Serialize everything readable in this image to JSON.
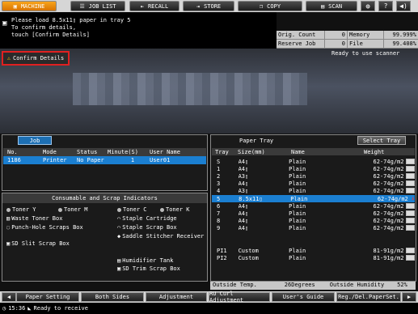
{
  "tabs": [
    {
      "label": "MACHINE",
      "icon": "machine-icon",
      "active": true
    },
    {
      "label": "JOB LIST",
      "icon": "job-list-icon",
      "active": false
    },
    {
      "label": "RECALL",
      "icon": "recall-icon",
      "active": false
    },
    {
      "label": "STORE",
      "icon": "store-icon",
      "active": false
    },
    {
      "label": "COPY",
      "icon": "copy-icon",
      "active": false
    },
    {
      "label": "SCAN",
      "icon": "scan-icon",
      "active": false
    }
  ],
  "message": {
    "line1": "Please load   8.5x11▯   paper in tray 5",
    "line2": "To confirm details,",
    "line3": "touch [Confirm Details]"
  },
  "status": {
    "orig_count_label": "Orig. Count",
    "orig_count": "0",
    "memory_label": "Memory",
    "memory": "99.999%",
    "reserve_label": "Reserve Job",
    "reserve": "0",
    "file_amount_label": "File Amount",
    "file_amount": "99.408%"
  },
  "confirm_label": "Confirm Details",
  "ready_scanner": "Ready to use scanner",
  "job": {
    "tab_label": "Job",
    "headers": [
      "No.",
      "Mode",
      "Status",
      "Minute(S)",
      "User Name"
    ],
    "rows": [
      [
        "1186",
        "Printer",
        "No Paper",
        "1",
        "User01"
      ]
    ]
  },
  "consumables": {
    "title": "Consumable and Scrap Indicators",
    "items": [
      "Toner Y",
      "Toner M",
      "Toner C",
      "Toner K",
      "Waste Toner Box",
      "Staple Cartridge",
      "Punch-Hole Scraps Box",
      "Staple Scrap Box",
      "Saddle Stitcher Receiver",
      "SD Slit Scrap Box",
      "Humidifier Tank",
      "SD Trim Scrap Box"
    ]
  },
  "tray": {
    "title": "Paper Tray",
    "select_label": "Select Tray",
    "headers": [
      "Tray",
      "Size(mm)",
      "Name",
      "Weight"
    ],
    "rows": [
      [
        "S",
        "A4▯",
        "Plain",
        "62-74g/m2"
      ],
      [
        "1",
        "A4▯",
        "Plain",
        "62-74g/m2"
      ],
      [
        "2",
        "A3▯",
        "Plain",
        "62-74g/m2"
      ],
      [
        "3",
        "A4▯",
        "Plain",
        "62-74g/m2"
      ],
      [
        "4",
        "A3▯",
        "Plain",
        "62-74g/m2"
      ],
      [
        "5",
        "8.5x11▯",
        "Plain",
        "62-74g/m2"
      ],
      [
        "6",
        "A4▯",
        "Plain",
        "62-74g/m2"
      ],
      [
        "7",
        "A4▯",
        "Plain",
        "62-74g/m2"
      ],
      [
        "8",
        "A4▯",
        "Plain",
        "62-74g/m2"
      ],
      [
        "9",
        "A4▯",
        "Plain",
        "62-74g/m2"
      ],
      [
        "PI1",
        "Custom",
        "Plain",
        "81-91g/m2"
      ],
      [
        "PI2",
        "Custom",
        "Plain",
        "81-91g/m2"
      ]
    ],
    "selected_row": 5
  },
  "outside": {
    "temp_label": "Outside Temp.",
    "temp": "26Degrees",
    "hum_label": "Outside Humidity",
    "hum": "52%"
  },
  "bottom_buttons": [
    "Paper Setting",
    "Both Sides",
    "Adjustment",
    "RU Curl Adjustment",
    "User's Guide",
    "Reg./Del.PaperSet."
  ],
  "footer": {
    "time": "15:36",
    "status": "Ready to receive"
  }
}
